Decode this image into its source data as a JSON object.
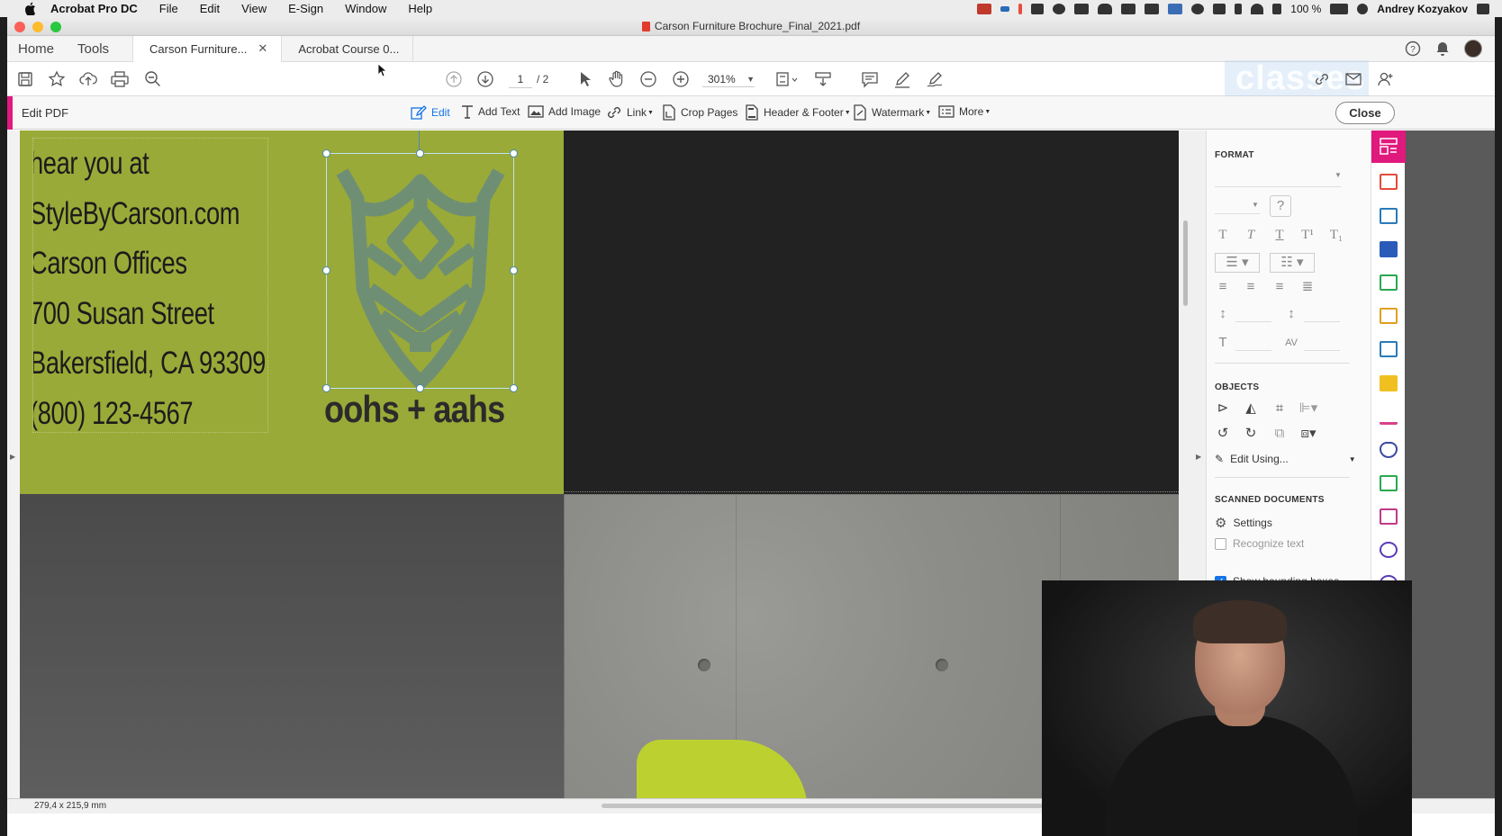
{
  "menubar": {
    "app_name": "Acrobat Pro DC",
    "items": [
      "File",
      "Edit",
      "View",
      "E-Sign",
      "Window",
      "Help"
    ],
    "battery": "100 %",
    "user": "Andrey Kozyakov"
  },
  "window": {
    "title": "Carson Furniture Brochure_Final_2021.pdf"
  },
  "tabs": {
    "home": "Home",
    "tools": "Tools",
    "docs": [
      {
        "label": "Carson Furniture...",
        "active": true
      },
      {
        "label": "Acrobat Course 0...",
        "active": false
      }
    ]
  },
  "toolbar": {
    "page_current": "1",
    "page_total": "/ 2",
    "zoom": "301%",
    "overlay_text": "classes"
  },
  "editbar": {
    "title": "Edit PDF",
    "tools": [
      {
        "label": "Edit",
        "icon": "edit-icon",
        "active": true
      },
      {
        "label": "Add Text",
        "icon": "add-text-icon"
      },
      {
        "label": "Add Image",
        "icon": "add-image-icon"
      },
      {
        "label": "Link",
        "icon": "link-icon",
        "dropdown": true
      },
      {
        "label": "Crop Pages",
        "icon": "crop-pages-icon"
      },
      {
        "label": "Header & Footer",
        "icon": "header-footer-icon",
        "dropdown": true
      },
      {
        "label": "Watermark",
        "icon": "watermark-icon",
        "dropdown": true
      },
      {
        "label": "More",
        "icon": "more-icon",
        "dropdown": true
      }
    ],
    "close_label": "Close"
  },
  "document": {
    "text_lines": [
      "hear you at",
      "StyleByCarson.com",
      "Carson Offices",
      "700 Susan Street",
      "Bakersfield, CA 93309",
      "(800) 123-4567"
    ],
    "logo_text": "oohs + aahs",
    "colors": {
      "green_panel": "#9aaa38",
      "logo": "#6c8a70",
      "dark_panel": "#222222"
    }
  },
  "format_panel": {
    "format_heading": "FORMAT",
    "objects_heading": "OBJECTS",
    "edit_using": "Edit Using...",
    "scanned_heading": "SCANNED DOCUMENTS",
    "settings_label": "Settings",
    "recognize_text": "Recognize text",
    "show_bounding": "Show bounding boxes"
  },
  "statusbar": {
    "page_size": "279,4 x 215,9 mm"
  }
}
